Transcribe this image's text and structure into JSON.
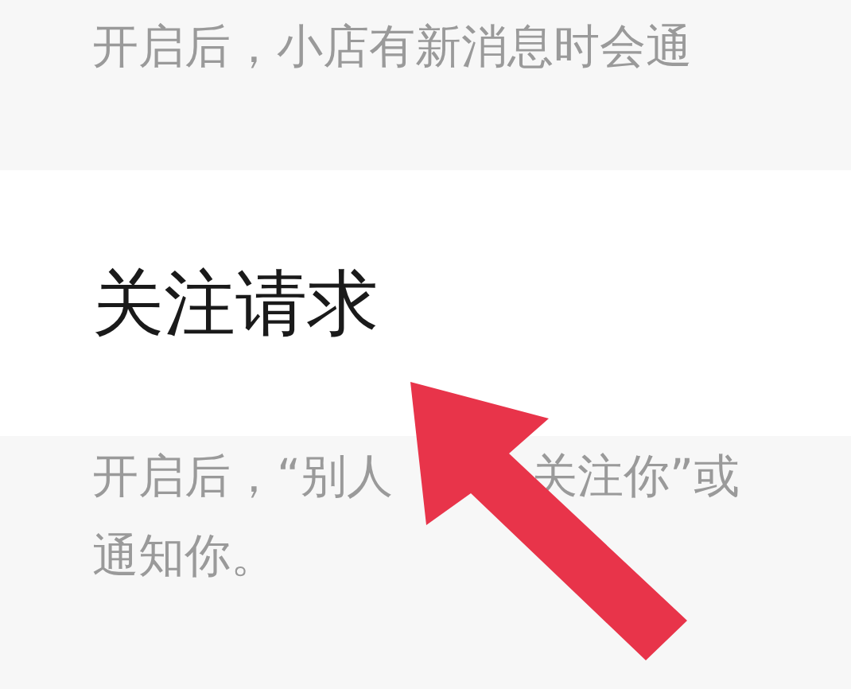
{
  "sections": [
    {
      "kind": "note",
      "lines": [
        [
          "开启后，小店有新消息时会通"
        ]
      ]
    },
    {
      "kind": "setting",
      "label": "关注请求"
    },
    {
      "kind": "note",
      "lines": [
        [
          "开启后，“别人",
          "关注你”或"
        ],
        [
          "通知你。"
        ]
      ]
    }
  ]
}
